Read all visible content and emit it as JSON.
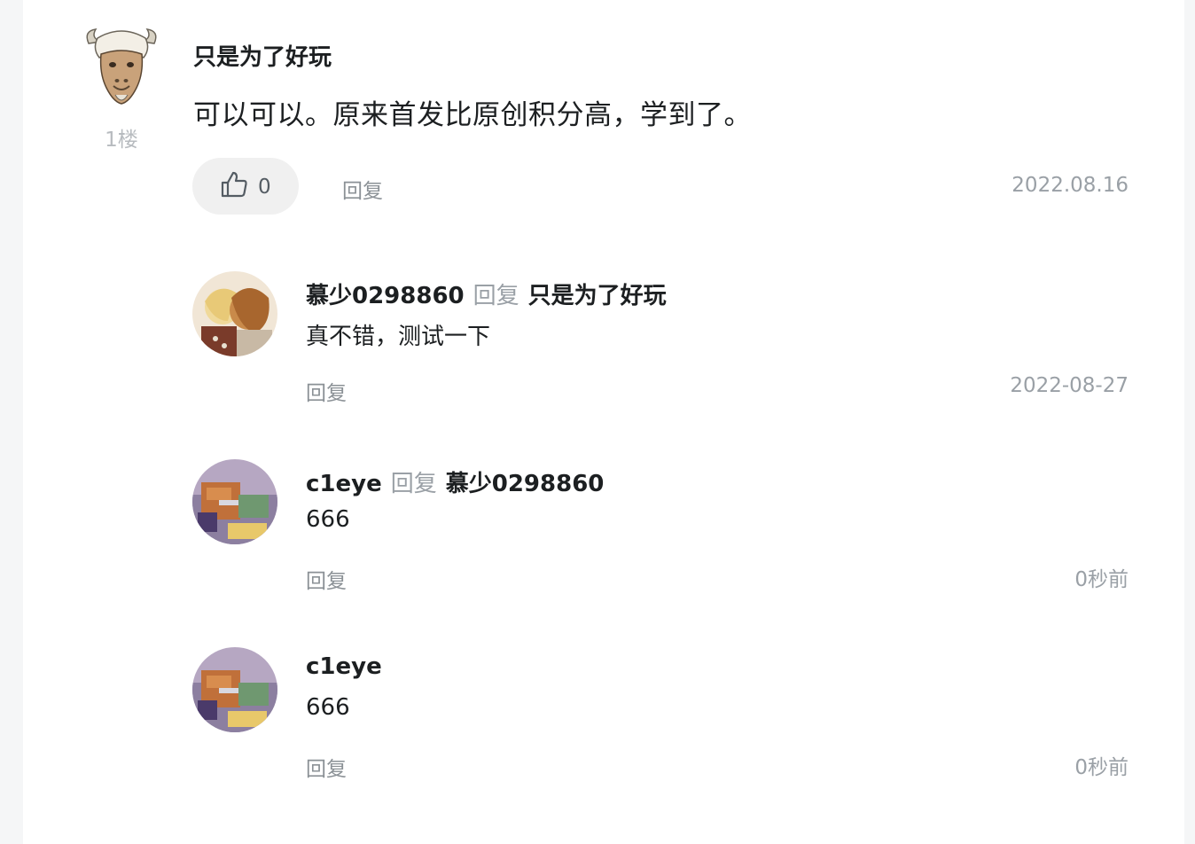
{
  "main_comment": {
    "author": "只是为了好玩",
    "floor": "1楼",
    "text": "可以可以。原来首发比原创积分高，学到了。",
    "like_count": "0",
    "reply_label": "回复",
    "date": "2022.08.16"
  },
  "replies": [
    {
      "author": "慕少0298860",
      "reply_word": "回复",
      "target": "只是为了好玩",
      "text": "真不错，测试一下",
      "reply_label": "回复",
      "date": "2022-08-27"
    },
    {
      "author": "c1eye",
      "reply_word": "回复",
      "target": "慕少0298860",
      "text": "666",
      "reply_label": "回复",
      "date": "0秒前"
    },
    {
      "author": "c1eye",
      "text": "666",
      "reply_label": "回复",
      "date": "0秒前"
    }
  ],
  "icons": {
    "like": "thumbs-up-icon"
  },
  "colors": {
    "background": "#f5f6f7",
    "card": "#ffffff",
    "text_primary": "#1c1f21",
    "text_muted": "#9aa0a6",
    "like_button_bg": "#f0f0f0"
  }
}
